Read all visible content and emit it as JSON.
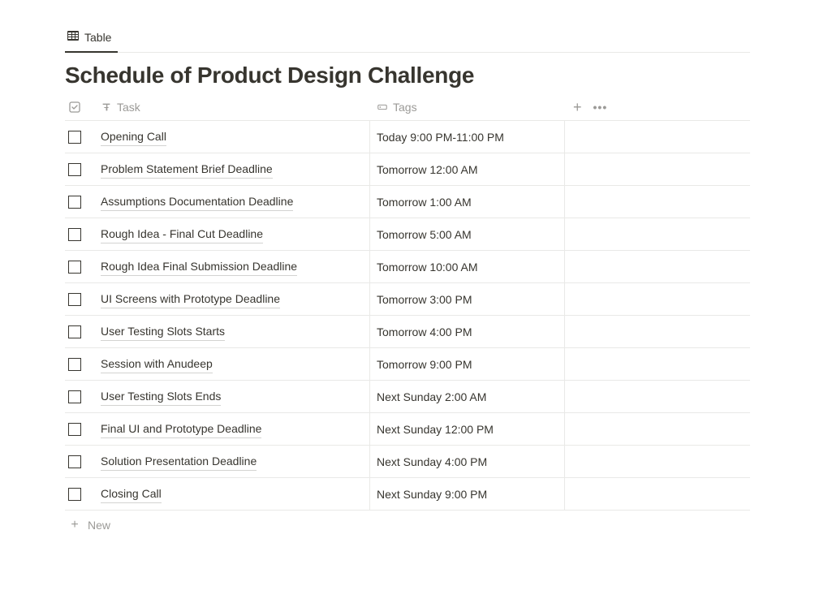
{
  "view": {
    "tab_label": "Table"
  },
  "page": {
    "title": "Schedule of Product Design Challenge"
  },
  "columns": {
    "task_label": "Task",
    "tags_label": "Tags"
  },
  "rows": [
    {
      "task": "Opening Call",
      "tags": "Today 9:00 PM-11:00 PM"
    },
    {
      "task": "Problem Statement Brief Deadline",
      "tags": "Tomorrow 12:00 AM"
    },
    {
      "task": "Assumptions Documentation Deadline",
      "tags": "Tomorrow 1:00 AM"
    },
    {
      "task": "Rough Idea - Final Cut Deadline",
      "tags": "Tomorrow 5:00 AM"
    },
    {
      "task": "Rough Idea Final Submission Deadline",
      "tags": "Tomorrow 10:00 AM"
    },
    {
      "task": "UI Screens with Prototype Deadline",
      "tags": "Tomorrow 3:00 PM"
    },
    {
      "task": "User Testing Slots Starts",
      "tags": "Tomorrow 4:00 PM"
    },
    {
      "task": "Session with Anudeep",
      "tags": "Tomorrow 9:00 PM"
    },
    {
      "task": "User Testing Slots Ends",
      "tags": "Next Sunday 2:00 AM"
    },
    {
      "task": "Final UI and Prototype Deadline",
      "tags": "Next Sunday 12:00 PM"
    },
    {
      "task": "Solution Presentation Deadline",
      "tags": "Next Sunday 4:00 PM"
    },
    {
      "task": "Closing Call",
      "tags": "Next Sunday 9:00 PM"
    }
  ],
  "new_row_label": "New"
}
